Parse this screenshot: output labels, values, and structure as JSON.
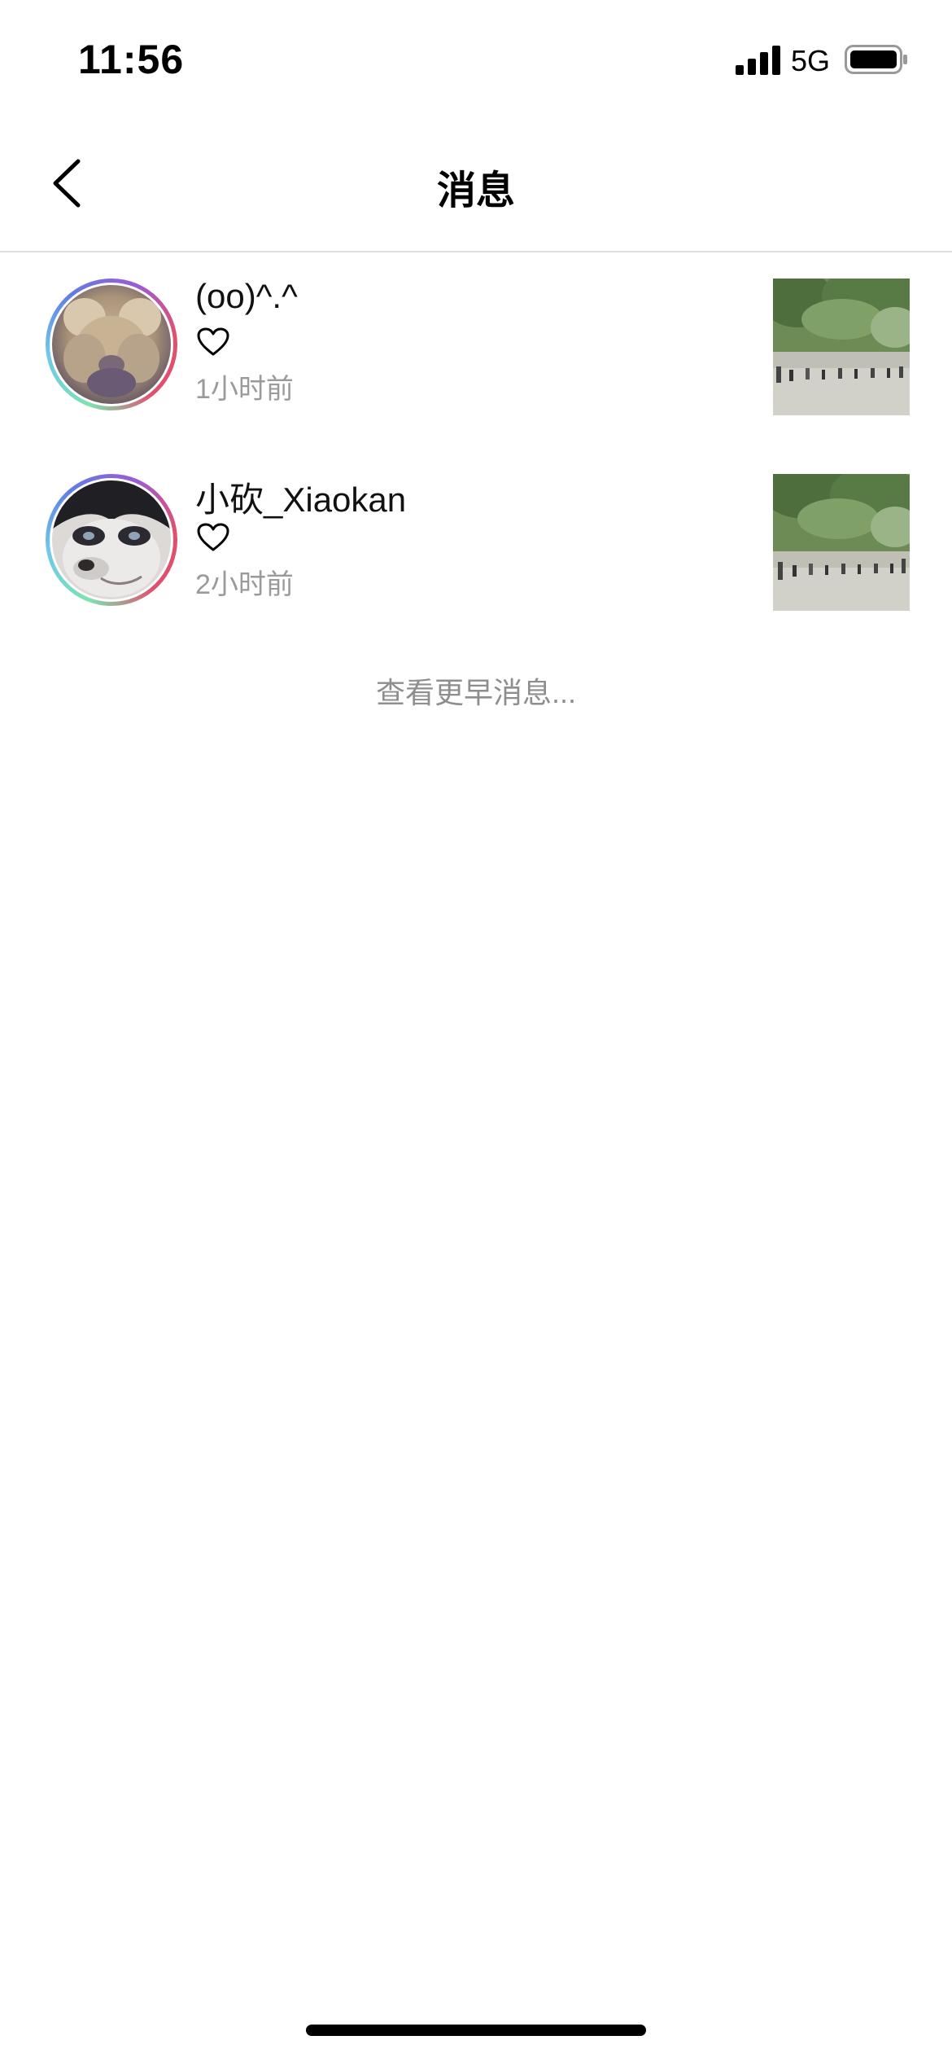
{
  "status_bar": {
    "time": "11:56",
    "network": "5G",
    "icons": [
      "signal-icon",
      "battery-icon"
    ]
  },
  "nav": {
    "title": "消息",
    "back_icon": "chevron-left-icon"
  },
  "notifications": [
    {
      "username": "(oo)^.^",
      "action_icon": "heart-icon",
      "time": "1小时前",
      "avatar": "teddy-bear-avatar",
      "thumbnail": "park-trees-photo"
    },
    {
      "username": "小砍_Xiaokan",
      "action_icon": "heart-icon",
      "time": "2小时前",
      "avatar": "husky-dog-avatar",
      "thumbnail": "park-trees-photo"
    }
  ],
  "see_earlier": "查看更早消息..."
}
